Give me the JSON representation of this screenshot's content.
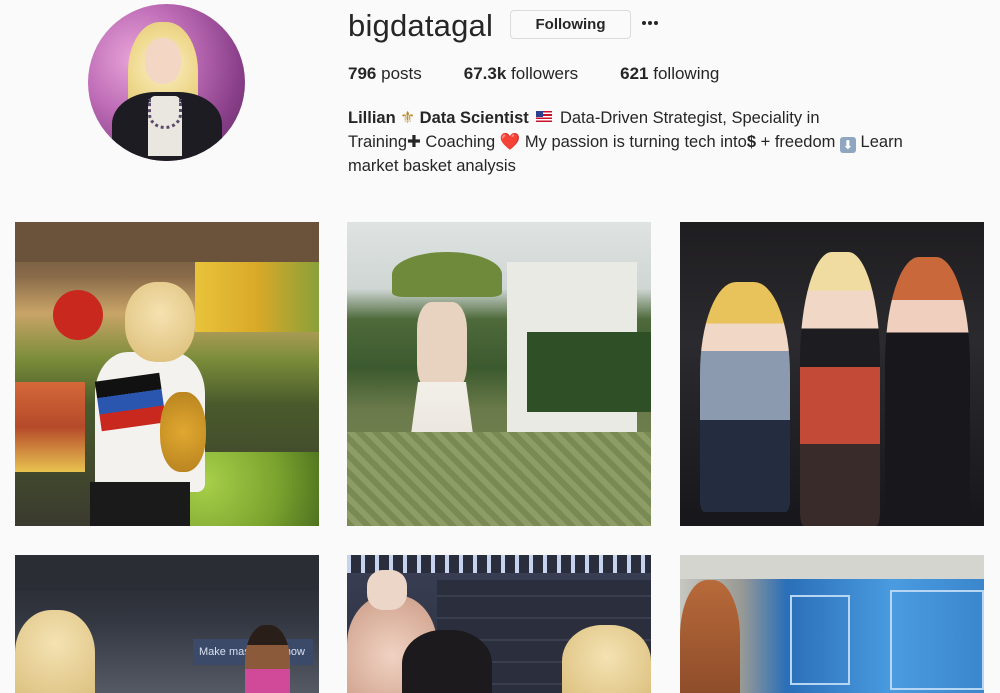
{
  "profile": {
    "username": "bigdatagal",
    "follow_label": "Following",
    "stats": {
      "posts_count": "796",
      "posts_label": "posts",
      "followers_count": "67.3k",
      "followers_label": "followers",
      "following_count": "621",
      "following_label": "following"
    },
    "bio": {
      "name": "Lillian",
      "fleur": "⚜",
      "title": "Data Scientist",
      "line1_rest": "Data-Driven Strategist, Speciality in",
      "training": "Training",
      "plus": "✚",
      "coaching": "Coaching",
      "heart": "❤️",
      "passion": "My passion is turning tech into",
      "dollar": "$",
      "freedom": "+ freedom",
      "down_arrow": "⬇",
      "learn": "Learn",
      "line3": "market basket analysis"
    }
  },
  "grid": {
    "tiles": [
      {
        "id": "post-1",
        "subject": "market-photo"
      },
      {
        "id": "post-2",
        "subject": "umbrella-photo"
      },
      {
        "id": "post-3",
        "subject": "group-photo"
      },
      {
        "id": "post-4",
        "subject": "conference-photo",
        "overlay_text": "Make massive"
      },
      {
        "id": "post-5",
        "subject": "selfie-photo"
      },
      {
        "id": "post-6",
        "subject": "booth-photo"
      }
    ],
    "tile_4_suffix": "now"
  },
  "colors": {
    "accent": "#262626",
    "border": "#dbdbdb",
    "background": "#fafafa"
  }
}
